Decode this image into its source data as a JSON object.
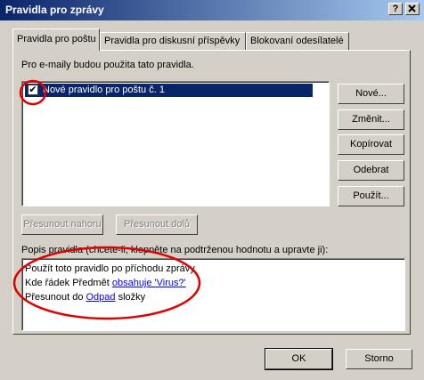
{
  "window": {
    "title": "Pravidla pro zprávy",
    "help_button": "?",
    "close_button": "X"
  },
  "tabs": [
    {
      "label": "Pravidla pro poštu"
    },
    {
      "label": "Pravidla pro diskusní příspěvky"
    },
    {
      "label": "Blokovaní odesílatelé"
    }
  ],
  "rules": {
    "intro": "Pro e-maily budou použita tato pravidla.",
    "items": [
      {
        "name": "Nové pravidlo pro poštu č. 1",
        "checked": true,
        "checkmark": "✔"
      }
    ]
  },
  "buttons": {
    "new": "Nové...",
    "modify": "Změnit...",
    "copy": "Kopírovat",
    "remove": "Odebrat",
    "apply": "Použít...",
    "move_up": "Přesunout nahoru",
    "move_down": "Přesunout dolů",
    "ok": "OK",
    "cancel": "Storno"
  },
  "description": {
    "label": "Popis pravidla (chcete-li, klepněte na podtrženou hodnotu a upravte ji):",
    "line1": "Použít toto pravidlo po příchodu zprávy",
    "line2_prefix": "Kde řádek Předmět",
    "line2_link": "obsahuje 'Virus?'",
    "line3_prefix": "Přesunout do",
    "line3_link": "Odpad",
    "line3_suffix": "složky"
  },
  "colors": {
    "annotation": "#e00000",
    "selection": "#0a246a",
    "link": "#0000ff"
  }
}
